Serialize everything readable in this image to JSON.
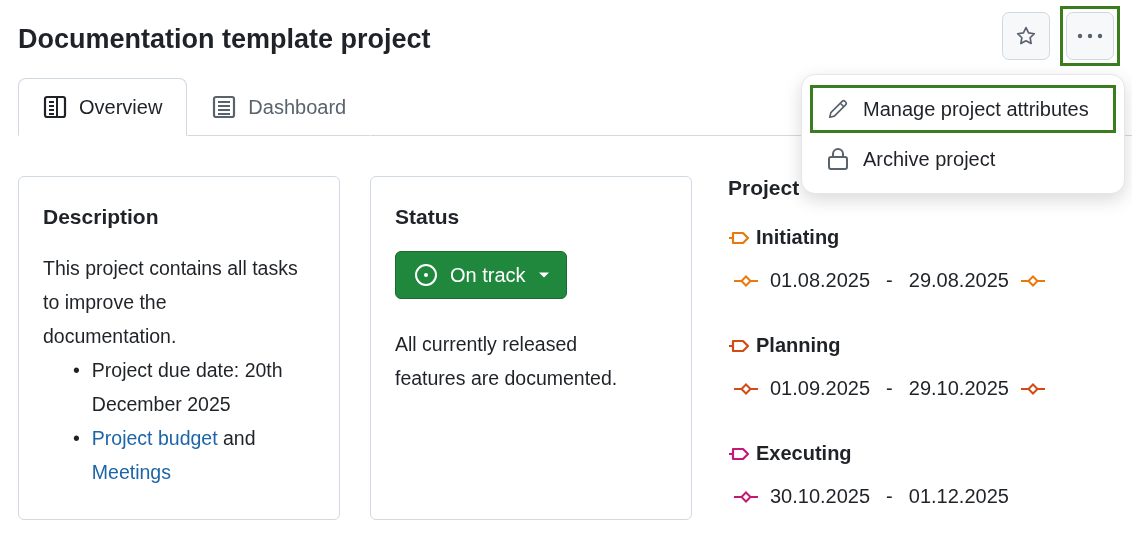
{
  "title": "Documentation template project",
  "header_buttons": {
    "favorite": {
      "highlighted": false
    },
    "more": {
      "highlighted": true
    }
  },
  "tabs": [
    {
      "label": "Overview",
      "selected": true
    },
    {
      "label": "Dashboard",
      "selected": false
    }
  ],
  "menu": {
    "items": [
      {
        "label": "Manage project attributes",
        "highlighted": true
      },
      {
        "label": "Archive project",
        "highlighted": false
      }
    ]
  },
  "description": {
    "heading": "Description",
    "text": "This project contains all tasks to improve the documentation.",
    "bullets": [
      {
        "marker": "•",
        "parts": [
          {
            "text": "Project due date: 20th December 2025",
            "link": false
          }
        ]
      },
      {
        "marker": "•",
        "parts": [
          {
            "text": "Project budget",
            "link": true
          },
          {
            "text": "and",
            "link": false
          },
          {
            "text": "Meetings",
            "link": true
          }
        ]
      }
    ]
  },
  "status": {
    "heading": "Status",
    "value": "On track",
    "text": "All currently released features are documented."
  },
  "lifecycle": {
    "heading": "Project",
    "phases": [
      {
        "name": "Initiating",
        "color": "#e8790c",
        "start": "01.08.2025",
        "end": "29.08.2025",
        "separator": "-",
        "end_marker": true
      },
      {
        "name": "Planning",
        "color": "#d24a16",
        "start": "01.09.2025",
        "end": "29.10.2025",
        "separator": "-",
        "end_marker": true
      },
      {
        "name": "Executing",
        "color": "#c4177a",
        "start": "30.10.2025",
        "end": "01.12.2025",
        "separator": "-",
        "end_marker": false
      }
    ]
  }
}
